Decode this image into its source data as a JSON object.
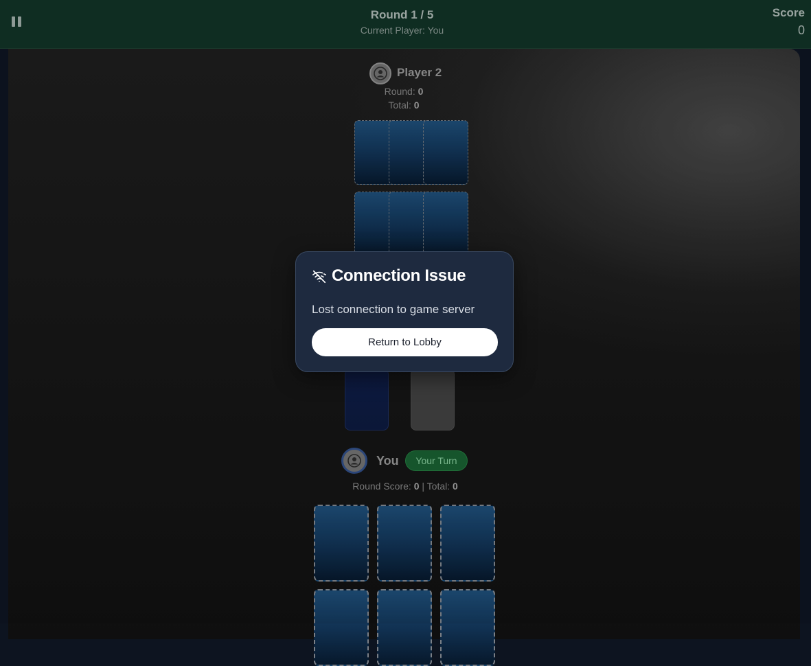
{
  "header": {
    "pause_icon": "pause-icon",
    "round_label": "Round 1 / 5",
    "current_player_label": "Current Player: You",
    "score_label": "Score",
    "score_value": "0"
  },
  "opponent": {
    "name": "Player 2",
    "avatar_icon": "user-avatar-icon",
    "round_label": "Round: ",
    "round_value": "0",
    "total_label": "Total: ",
    "total_value": "0",
    "cards_face_down": 6
  },
  "piles": {
    "draw_pile": "draw-pile",
    "discard_pile": "discard-pile"
  },
  "me": {
    "name": "You",
    "avatar_icon": "user-avatar-icon",
    "turn_badge": "Your Turn",
    "round_score_label": "Round Score: ",
    "round_score_value": "0",
    "separator": " | ",
    "total_label": "Total: ",
    "total_value": "0",
    "cards_face_down": 6
  },
  "modal": {
    "icon": "wifi-off-icon",
    "title": "Connection Issue",
    "message": "Lost connection to game server",
    "button_label": "Return to Lobby"
  },
  "colors": {
    "header_bg": "#0f2d22",
    "modal_bg": "#1e2a3f",
    "card_back": "#113253",
    "turn_badge_bg": "#185a2f"
  }
}
